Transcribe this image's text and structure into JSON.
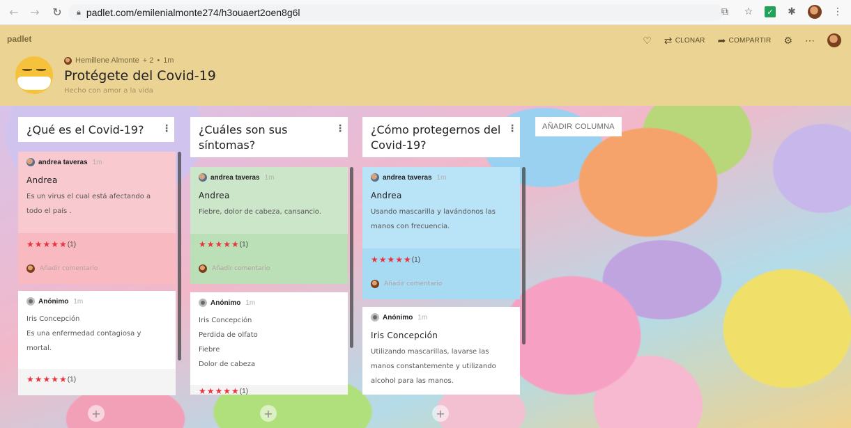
{
  "browser": {
    "url": "padlet.com/emilenialmonte274/h3ouaert2oen8g6l"
  },
  "header": {
    "brand": "padlet",
    "actions": {
      "clone": "CLONAR",
      "share": "COMPARTIR"
    },
    "author": "Hemillene Almonte",
    "plus": "+ 2",
    "sep": "•",
    "time": "1m",
    "title": "Protégete del Covid-19",
    "subtitle": "Hecho con amor a la vida"
  },
  "add_column": "AÑADIR COLUMNA",
  "columns": [
    {
      "title": "¿Qué es el Covid-19?",
      "cards": [
        {
          "author": "andrea taveras",
          "time": "1m",
          "title": "Andrea",
          "body": "Es un virus el cual está afectando a todo el país .",
          "rating_stars": "★★★★★",
          "rating_count": "(1)",
          "comment_placeholder": "Añadir comentario"
        },
        {
          "author": "Anónimo",
          "time": "1m",
          "body_lines": [
            "Iris Concepción",
            "Es una enfermedad contagiosa y",
            "mortal."
          ],
          "rating_stars": "★★★★★",
          "rating_count": "(1)"
        }
      ]
    },
    {
      "title": "¿Cuáles son sus síntomas?",
      "cards": [
        {
          "author": "andrea taveras",
          "time": "1m",
          "title": "Andrea",
          "body": "Fiebre, dolor de cabeza, cansancio.",
          "rating_stars": "★★★★★",
          "rating_count": "(1)",
          "comment_placeholder": "Añadir comentario"
        },
        {
          "author": "Anónimo",
          "time": "1m",
          "body_lines": [
            "Iris Concepción",
            "Perdida de olfato",
            "Fiebre",
            "Dolor de cabeza"
          ],
          "rating_stars": "★★★★★",
          "rating_count": "(1)"
        }
      ]
    },
    {
      "title": "¿Cómo protegernos del Covid-19?",
      "cards": [
        {
          "author": "andrea taveras",
          "time": "1m",
          "title": "Andrea",
          "body": "Usando mascarilla y lavándonos las manos con frecuencia.",
          "rating_stars": "★★★★★",
          "rating_count": "(1)",
          "comment_placeholder": "Añadir comentario"
        },
        {
          "author": "Anónimo",
          "time": "1m",
          "title": "Iris Concepción",
          "body": "Utilizando mascarillas, lavarse las manos constantemente y utilizando alcohol para las manos."
        }
      ]
    }
  ],
  "add_post": "+",
  "colors": {
    "header_bg": "#ebd394",
    "card_red": "#f8c9cf",
    "card_green": "#cbe6c8",
    "card_blue": "#b9e3f6",
    "star": "#e8323c"
  }
}
